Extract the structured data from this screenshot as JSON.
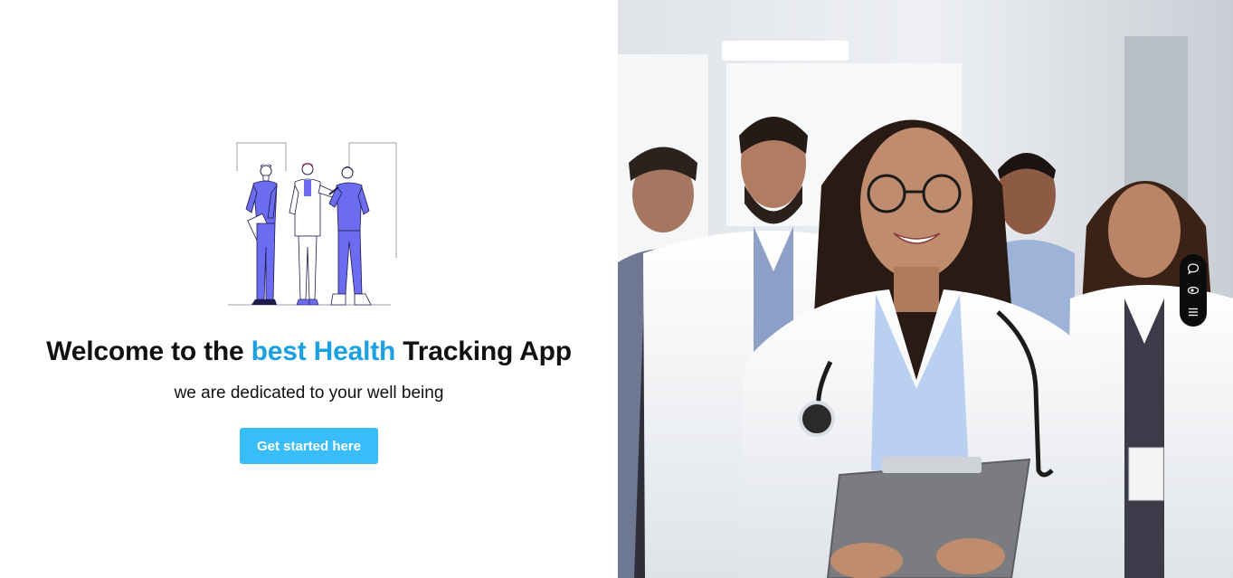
{
  "hero": {
    "title_prefix": "Welcome to the ",
    "title_accent": "best Health",
    "title_suffix": " Tracking App",
    "subtitle": "we are dedicated to your well being",
    "cta_label": "Get started here"
  },
  "colors": {
    "accent_text": "#1ba1e2",
    "cta_background": "#38bdf8",
    "illustration_purple": "#6c6cf0",
    "toolbar_background": "#0b0b0b"
  },
  "illustration": {
    "icon": "medical-team-illustration"
  },
  "photo": {
    "icon": "doctors-team-photo"
  },
  "toolbar": {
    "items": [
      {
        "icon": "chat-bubble-icon"
      },
      {
        "icon": "eye-icon"
      },
      {
        "icon": "menu-icon"
      }
    ]
  }
}
